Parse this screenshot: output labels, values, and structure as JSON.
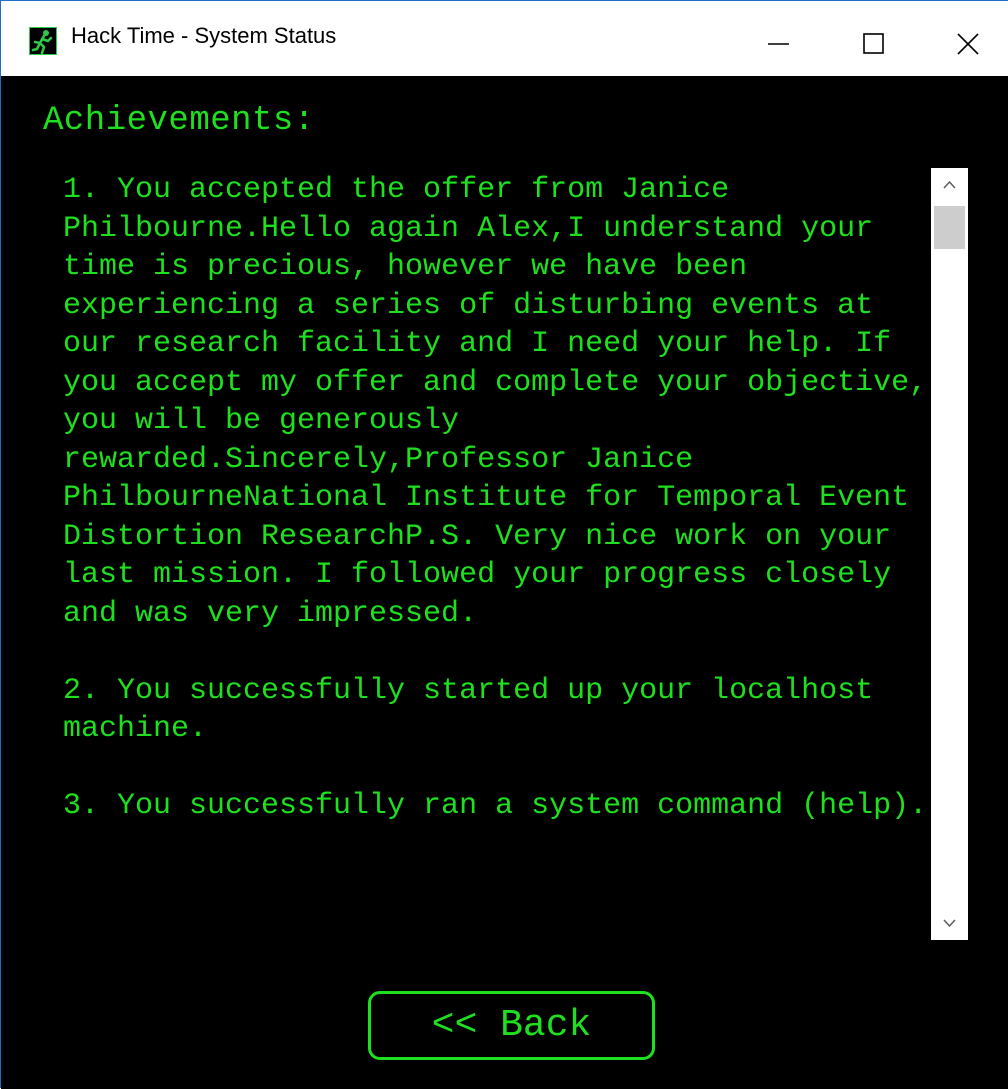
{
  "window": {
    "title": "Hack Time - System Status",
    "icon": "running-man-icon",
    "controls": [
      "minimize-icon",
      "maximize-icon",
      "close-icon"
    ]
  },
  "colors": {
    "terminal_green": "#1ee01e",
    "background": "#000000",
    "titlebar": "#ffffff",
    "icon_green": "#2ec84a"
  },
  "main": {
    "heading": "Achievements:",
    "achievements": [
      "1. You accepted the offer from Janice Philbourne.Hello again Alex,I understand your time is precious, however we have been experiencing a series of disturbing events at our research facility and I need your help. If you accept my offer and complete your objective, you will be generously rewarded.Sincerely,Professor Janice PhilbourneNational Institute for Temporal Event Distortion ResearchP.S. Very nice work on your last mission. I followed your progress closely and was very impressed.",
      "2. You successfully started up your localhost machine.",
      "3. You successfully ran a system command (help)."
    ],
    "back_button_label": "<< Back"
  }
}
